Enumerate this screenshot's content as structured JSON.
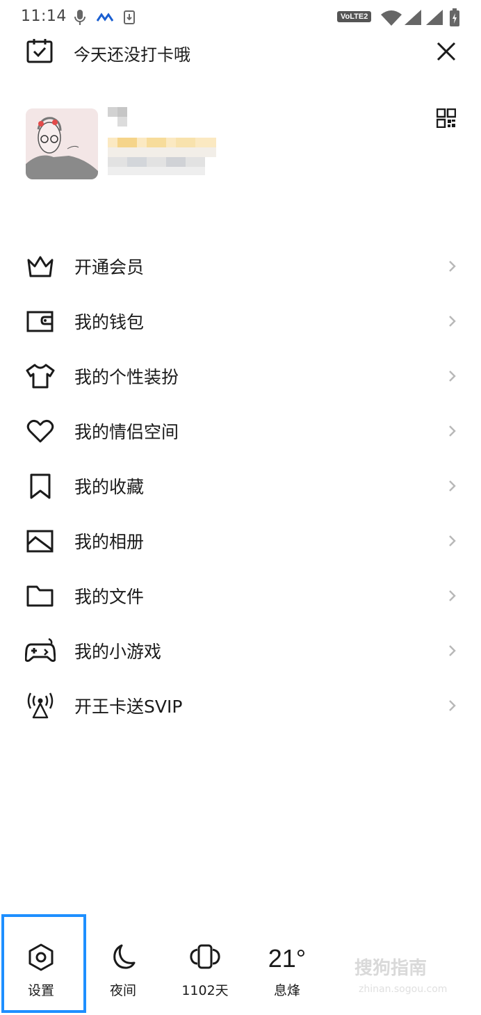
{
  "status_bar": {
    "time": "11:14",
    "network_badge": "VoLTE2"
  },
  "header": {
    "checkin_text": "今天还没打卡哦"
  },
  "menu": [
    {
      "label": "开通会员",
      "icon": "crown-icon"
    },
    {
      "label": "我的钱包",
      "icon": "wallet-icon"
    },
    {
      "label": "我的个性装扮",
      "icon": "tshirt-icon"
    },
    {
      "label": "我的情侣空间",
      "icon": "heart-icon"
    },
    {
      "label": "我的收藏",
      "icon": "bookmark-icon"
    },
    {
      "label": "我的相册",
      "icon": "image-icon"
    },
    {
      "label": "我的文件",
      "icon": "folder-icon"
    },
    {
      "label": "我的小游戏",
      "icon": "gamepad-icon"
    },
    {
      "label": "开王卡送SVIP",
      "icon": "broadcast-icon"
    }
  ],
  "bottom": {
    "settings_label": "设置",
    "night_label": "夜间",
    "days_label": "1102天",
    "temperature": "21°",
    "city": "息烽"
  },
  "watermark": {
    "text": "搜狗指南",
    "sub": "zhinan.sogou.com"
  },
  "colors": {
    "highlight": "#1e8fff",
    "text": "#1a1a1a",
    "arrow": "#b8b8b8"
  }
}
